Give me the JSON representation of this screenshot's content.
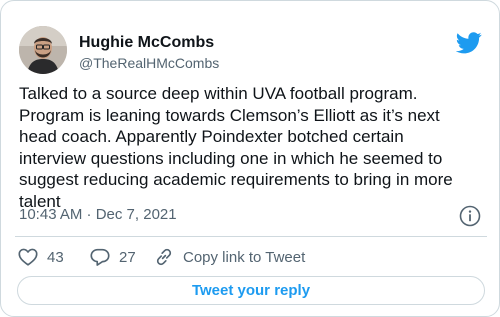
{
  "author": {
    "name": "Hughie McCombs",
    "handle": "@TheRealHMcCombs"
  },
  "tweet": {
    "text": "Talked to a source deep within UVA football program.\nProgram is leaning towards Clemson’s Elliott as it’s next\nhead coach. Apparently Poindexter botched certain\ninterview questions including one in which he seemed to\nsuggest reducing academic requirements to bring in more\ntalent",
    "timestamp": "10:43 AM · Dec 7, 2021"
  },
  "actions": {
    "like_count": "43",
    "reply_count": "27",
    "copy_label": "Copy link to Tweet"
  },
  "reply_button": {
    "label": "Tweet your reply"
  },
  "colors": {
    "accent": "#1d9bf0",
    "muted_text": "#536471",
    "border": "#cfd9de"
  },
  "icons": [
    "avatar-photo",
    "twitter-bird-icon",
    "info-icon",
    "heart-icon",
    "reply-bubble-icon",
    "link-icon"
  ]
}
